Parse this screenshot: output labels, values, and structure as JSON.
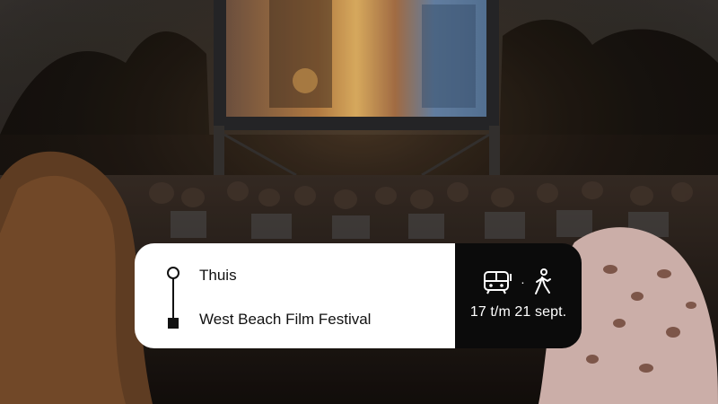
{
  "route": {
    "origin": "Thuis",
    "destination": "West Beach Film Festival"
  },
  "travel": {
    "modes": [
      "bus-tram-icon",
      "walking-icon"
    ],
    "separator": "·",
    "dates": "17 t/m 21 sept."
  },
  "colors": {
    "card_light": "#ffffff",
    "card_dark": "#0b0b0b",
    "text_dark": "#111111",
    "text_light": "#ffffff"
  }
}
